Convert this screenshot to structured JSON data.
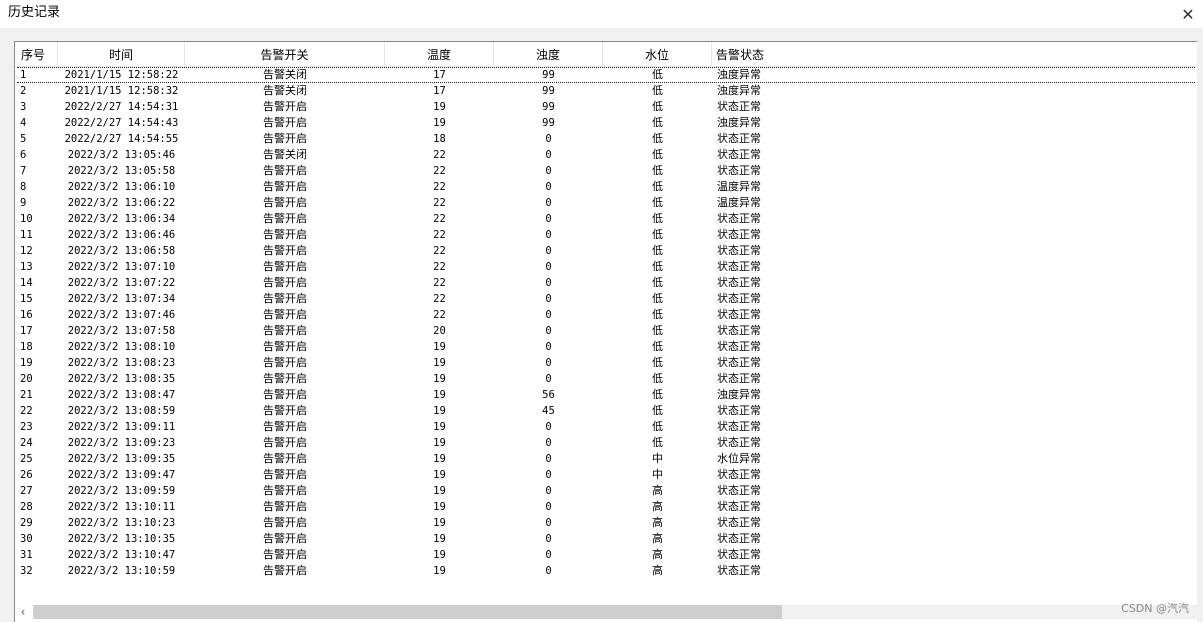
{
  "window": {
    "title": "历史记录"
  },
  "columns": [
    "序号",
    "时间",
    "告警开关",
    "温度",
    "浊度",
    "水位",
    "告警状态"
  ],
  "rows": [
    [
      "1",
      "2021/1/15 12:58:22",
      "告警关闭",
      "17",
      "99",
      "低",
      "浊度异常"
    ],
    [
      "2",
      "2021/1/15 12:58:32",
      "告警关闭",
      "17",
      "99",
      "低",
      "浊度异常"
    ],
    [
      "3",
      "2022/2/27 14:54:31",
      "告警开启",
      "19",
      "99",
      "低",
      "状态正常"
    ],
    [
      "4",
      "2022/2/27 14:54:43",
      "告警开启",
      "19",
      "99",
      "低",
      "浊度异常"
    ],
    [
      "5",
      "2022/2/27 14:54:55",
      "告警开启",
      "18",
      "0",
      "低",
      "状态正常"
    ],
    [
      "6",
      "2022/3/2 13:05:46",
      "告警关闭",
      "22",
      "0",
      "低",
      "状态正常"
    ],
    [
      "7",
      "2022/3/2 13:05:58",
      "告警开启",
      "22",
      "0",
      "低",
      "状态正常"
    ],
    [
      "8",
      "2022/3/2 13:06:10",
      "告警开启",
      "22",
      "0",
      "低",
      "温度异常"
    ],
    [
      "9",
      "2022/3/2 13:06:22",
      "告警开启",
      "22",
      "0",
      "低",
      "温度异常"
    ],
    [
      "10",
      "2022/3/2 13:06:34",
      "告警开启",
      "22",
      "0",
      "低",
      "状态正常"
    ],
    [
      "11",
      "2022/3/2 13:06:46",
      "告警开启",
      "22",
      "0",
      "低",
      "状态正常"
    ],
    [
      "12",
      "2022/3/2 13:06:58",
      "告警开启",
      "22",
      "0",
      "低",
      "状态正常"
    ],
    [
      "13",
      "2022/3/2 13:07:10",
      "告警开启",
      "22",
      "0",
      "低",
      "状态正常"
    ],
    [
      "14",
      "2022/3/2 13:07:22",
      "告警开启",
      "22",
      "0",
      "低",
      "状态正常"
    ],
    [
      "15",
      "2022/3/2 13:07:34",
      "告警开启",
      "22",
      "0",
      "低",
      "状态正常"
    ],
    [
      "16",
      "2022/3/2 13:07:46",
      "告警开启",
      "22",
      "0",
      "低",
      "状态正常"
    ],
    [
      "17",
      "2022/3/2 13:07:58",
      "告警开启",
      "20",
      "0",
      "低",
      "状态正常"
    ],
    [
      "18",
      "2022/3/2 13:08:10",
      "告警开启",
      "19",
      "0",
      "低",
      "状态正常"
    ],
    [
      "19",
      "2022/3/2 13:08:23",
      "告警开启",
      "19",
      "0",
      "低",
      "状态正常"
    ],
    [
      "20",
      "2022/3/2 13:08:35",
      "告警开启",
      "19",
      "0",
      "低",
      "状态正常"
    ],
    [
      "21",
      "2022/3/2 13:08:47",
      "告警开启",
      "19",
      "56",
      "低",
      "浊度异常"
    ],
    [
      "22",
      "2022/3/2 13:08:59",
      "告警开启",
      "19",
      "45",
      "低",
      "状态正常"
    ],
    [
      "23",
      "2022/3/2 13:09:11",
      "告警开启",
      "19",
      "0",
      "低",
      "状态正常"
    ],
    [
      "24",
      "2022/3/2 13:09:23",
      "告警开启",
      "19",
      "0",
      "低",
      "状态正常"
    ],
    [
      "25",
      "2022/3/2 13:09:35",
      "告警开启",
      "19",
      "0",
      "中",
      "水位异常"
    ],
    [
      "26",
      "2022/3/2 13:09:47",
      "告警开启",
      "19",
      "0",
      "中",
      "状态正常"
    ],
    [
      "27",
      "2022/3/2 13:09:59",
      "告警开启",
      "19",
      "0",
      "高",
      "状态正常"
    ],
    [
      "28",
      "2022/3/2 13:10:11",
      "告警开启",
      "19",
      "0",
      "高",
      "状态正常"
    ],
    [
      "29",
      "2022/3/2 13:10:23",
      "告警开启",
      "19",
      "0",
      "高",
      "状态正常"
    ],
    [
      "30",
      "2022/3/2 13:10:35",
      "告警开启",
      "19",
      "0",
      "高",
      "状态正常"
    ],
    [
      "31",
      "2022/3/2 13:10:47",
      "告警开启",
      "19",
      "0",
      "高",
      "状态正常"
    ],
    [
      "32",
      "2022/3/2 13:10:59",
      "告警开启",
      "19",
      "0",
      "高",
      "状态正常"
    ]
  ],
  "watermark": "CSDN @汽汽",
  "scrollbar": {
    "horizontal_visible_fraction": 0.64
  },
  "icons": {
    "close": "close-icon",
    "scroll_left": "chevron-left-icon"
  }
}
